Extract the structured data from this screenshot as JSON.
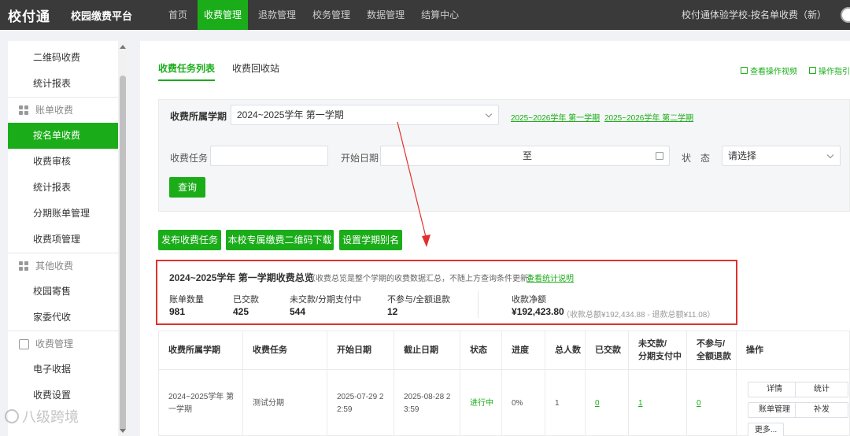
{
  "app": {
    "logo": "校付通",
    "platform": "校园缴费平台",
    "nav": [
      "首页",
      "收费管理",
      "退款管理",
      "校务管理",
      "数据管理",
      "结算中心"
    ],
    "school": "校付通体验学校-按名单收费（新）"
  },
  "sidebar": {
    "items_top": [
      "二维码收费",
      "统计报表"
    ],
    "group_bill": "账单收费",
    "bill_items": [
      "按名单收费",
      "收费审核",
      "统计报表",
      "分期账单管理",
      "收费项管理"
    ],
    "group_other": "其他收费",
    "other_items": [
      "校园寄售",
      "家委代收"
    ],
    "group_receipt": "收费管理",
    "receipt_items": [
      "电子收据",
      "收费设置"
    ]
  },
  "tabs": [
    "收费任务列表",
    "收费回收站"
  ],
  "help": {
    "video": "查看操作视频",
    "guide": "操作指引"
  },
  "filter": {
    "term_label": "收费所属学期",
    "term_value": "2024~2025学年 第一学期",
    "term_link1": "2025~2026学年 第一学期",
    "term_link2": "2025~2026学年 第二学期",
    "task_label": "收费任务",
    "start_label": "开始日期",
    "date_sep": "至",
    "status_label": "状　态",
    "status_value": "请选择",
    "query": "查询"
  },
  "actions": {
    "publish": "发布收费任务",
    "download_qr": "本校专属缴费二维码下载",
    "term_alias": "设置学期别名"
  },
  "summary": {
    "title": "2024~2025学年 第一学期收费总览",
    "note": "（收费总览是整个学期的收费数据汇总，不随上方查询条件更新）",
    "link": "查看统计说明",
    "stats": [
      {
        "label": "账单数量",
        "value": "981"
      },
      {
        "label": "已交款",
        "value": "425"
      },
      {
        "label": "未交款/分期支付中",
        "value": "544"
      },
      {
        "label": "不参与/全额退款",
        "value": "12"
      }
    ],
    "net_label": "收款净额",
    "net_value": "¥192,423.80",
    "net_detail": "（收款总额¥192,434.88 - 退款总额¥11.08）"
  },
  "table": {
    "headers": [
      "收费所属学期",
      "收费任务",
      "开始日期",
      "截止日期",
      "状态",
      "进度",
      "总人数",
      "已交款",
      "未交款/\n分期支付中",
      "不参与/\n全额退款",
      "操作"
    ],
    "row": {
      "term": "2024~2025学年 第一学期",
      "task": "测试分期",
      "start": "2025-07-29 22:59",
      "end": "2025-08-28 23:59",
      "status": "进行中",
      "progress": "0%",
      "total": "1",
      "paid": "0",
      "unpaid": "1",
      "refund": "0"
    },
    "ops": [
      "详情",
      "统计",
      "账单管理",
      "补发",
      "更多..."
    ]
  },
  "watermark": "八级跨境",
  "colors": {
    "brand": "#1aad19",
    "topbar": "#3a3a3a",
    "highlight": "#e0312e"
  }
}
